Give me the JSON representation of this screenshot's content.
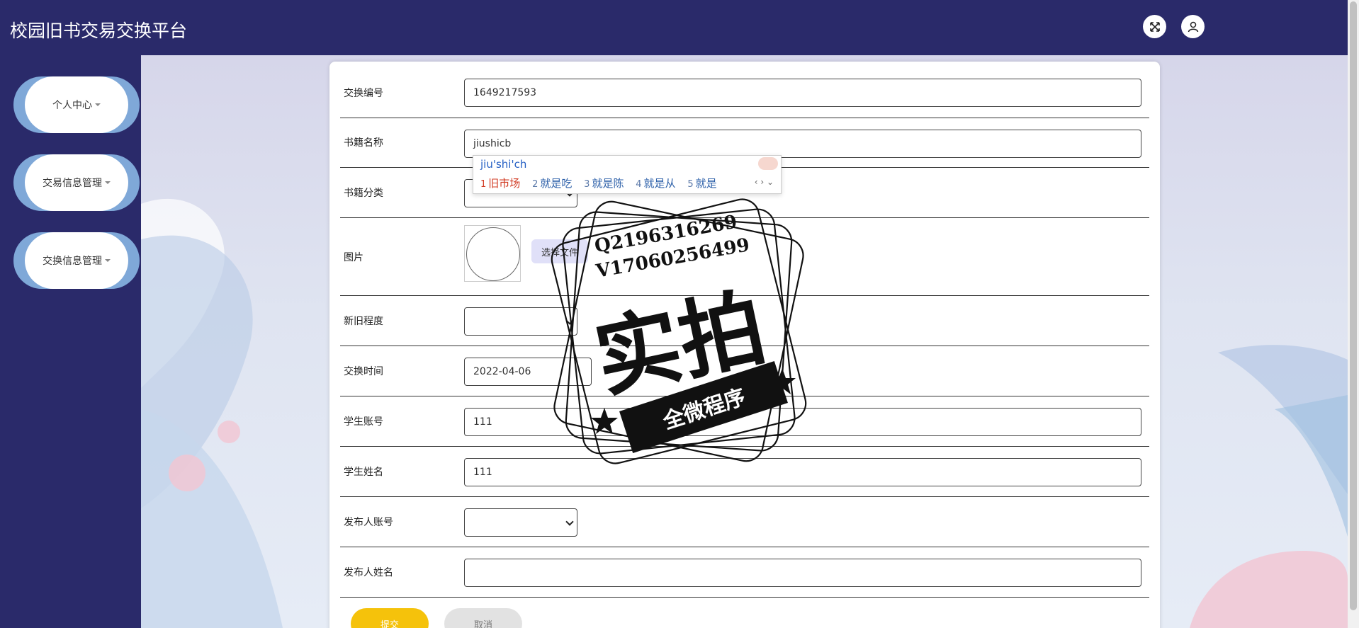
{
  "header": {
    "title": "校园旧书交易交换平台",
    "icons": [
      "fullscreen-icon",
      "user-icon"
    ]
  },
  "sidebar": {
    "items": [
      {
        "label": "个人中心"
      },
      {
        "label": "交易信息管理"
      },
      {
        "label": "交换信息管理"
      }
    ]
  },
  "form": {
    "fields": {
      "exchange_no": {
        "label": "交换编号",
        "value": "1649217593"
      },
      "book_name": {
        "label": "书籍名称",
        "value": "jiushicb"
      },
      "book_category": {
        "label": "书籍分类",
        "value": ""
      },
      "image": {
        "label": "图片",
        "file_button": "选择文件"
      },
      "condition": {
        "label": "新旧程度",
        "value": ""
      },
      "exchange_time": {
        "label": "交换时间",
        "value": "2022-04-06"
      },
      "student_account": {
        "label": "学生账号",
        "value": "111"
      },
      "student_name": {
        "label": "学生姓名",
        "value": "111"
      },
      "publisher_account": {
        "label": "发布人账号",
        "value": ""
      },
      "publisher_name": {
        "label": "发布人姓名",
        "value": ""
      }
    },
    "submit_label": "提交",
    "cancel_label": "取消"
  },
  "ime": {
    "composition": "jiu'shi'ch",
    "candidates": [
      {
        "num": "1",
        "text": "旧市场"
      },
      {
        "num": "2",
        "text": "就是吃"
      },
      {
        "num": "3",
        "text": "就是陈"
      },
      {
        "num": "4",
        "text": "就是从"
      },
      {
        "num": "5",
        "text": "就是"
      }
    ],
    "nav": "‹ › ⌄"
  },
  "watermark": {
    "line1": "Q2196316269",
    "line2": "V17060256499",
    "big": "实拍",
    "banner": "全微程序"
  },
  "colors": {
    "header_bg": "#2a2a6a",
    "submit": "#f5c20b",
    "cancel": "#e2e2e2",
    "sidebar_accent": "#7fa8d8"
  }
}
